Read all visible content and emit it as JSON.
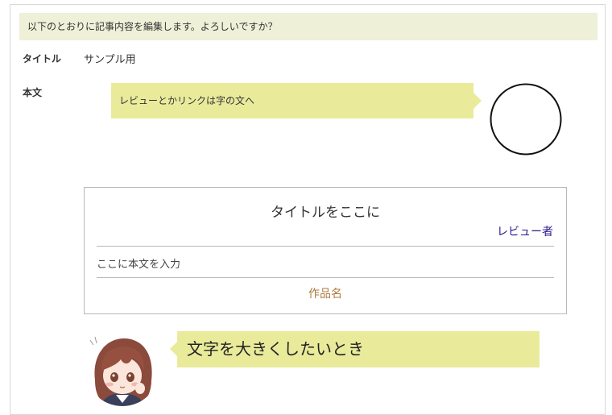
{
  "confirm": {
    "message": "以下のとおりに記事内容を編集します。よろしいですか？"
  },
  "fields": {
    "title_label": "タイトル",
    "title_value": "サンプル用",
    "body_label": "本文"
  },
  "content": {
    "bubble_small_text": "レビューとかリンクは字の文へ",
    "review_box": {
      "title": "タイトルをここに",
      "reviewer": "レビュー者",
      "body": "ここに本文を入力",
      "work_name": "作品名"
    },
    "bubble_large_text": "文字を大きくしたいとき"
  },
  "colors": {
    "confirm_bg": "#eef0d8",
    "bubble_bg": "#e9eb9b",
    "reviewer_text": "#2a1a8c",
    "work_name_text": "#b07a3e",
    "moon": "#ebcaab"
  },
  "icons": {
    "moon_avatar": "crescent-moon-icon",
    "girl_avatar": "anime-girl-avatar"
  }
}
